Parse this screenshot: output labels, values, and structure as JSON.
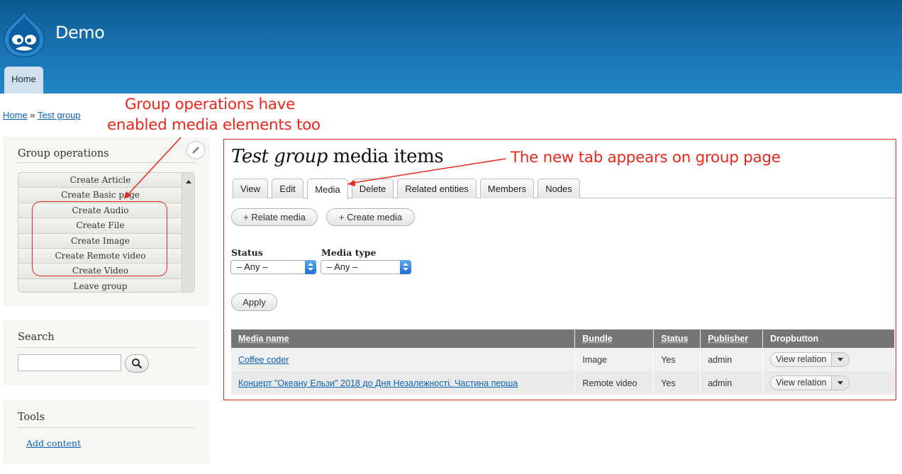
{
  "header": {
    "site_name": "Demo",
    "nav_tab": "Home"
  },
  "breadcrumb": {
    "home": "Home",
    "separator": "»",
    "current": "Test group"
  },
  "group_operations": {
    "title": "Group operations",
    "items": [
      "Create Article",
      "Create Basic page",
      "Create Audio",
      "Create File",
      "Create Image",
      "Create Remote video",
      "Create Video",
      "Leave group"
    ]
  },
  "search_block": {
    "title": "Search",
    "input_value": ""
  },
  "tools_block": {
    "title": "Tools",
    "link": "Add content"
  },
  "main": {
    "title_italic": "Test group",
    "title_rest": " media items",
    "tabs": [
      "View",
      "Edit",
      "Media",
      "Delete",
      "Related entities",
      "Members",
      "Nodes"
    ],
    "active_tab": "Media",
    "actions": [
      "+ Relate media",
      "+ Create media"
    ],
    "filters": {
      "status_label": "Status",
      "status_value": "– Any –",
      "type_label": "Media type",
      "type_value": "– Any –"
    },
    "apply_label": "Apply",
    "table": {
      "columns": [
        "Media name",
        "Bundle",
        "Status",
        "Publisher",
        "Dropbutton"
      ],
      "rows": [
        {
          "name": "Coffee coder",
          "bundle": "Image",
          "status": "Yes",
          "publisher": "admin",
          "action": "View relation"
        },
        {
          "name": "Концерт \"Океану Ельзи\" 2018 до Дня Незалежності. Частина перша",
          "bundle": "Remote video",
          "status": "Yes",
          "publisher": "admin",
          "action": "View relation"
        }
      ]
    }
  },
  "annotations": {
    "left_line1": "Group operations have",
    "left_line2": "enabled media elements too",
    "tab_note": "The new tab appears on group page"
  },
  "colors": {
    "annotation": "#e8281c",
    "header_top": "#0a5a8f",
    "header_bottom": "#2386c6",
    "link": "#0b62b0"
  }
}
